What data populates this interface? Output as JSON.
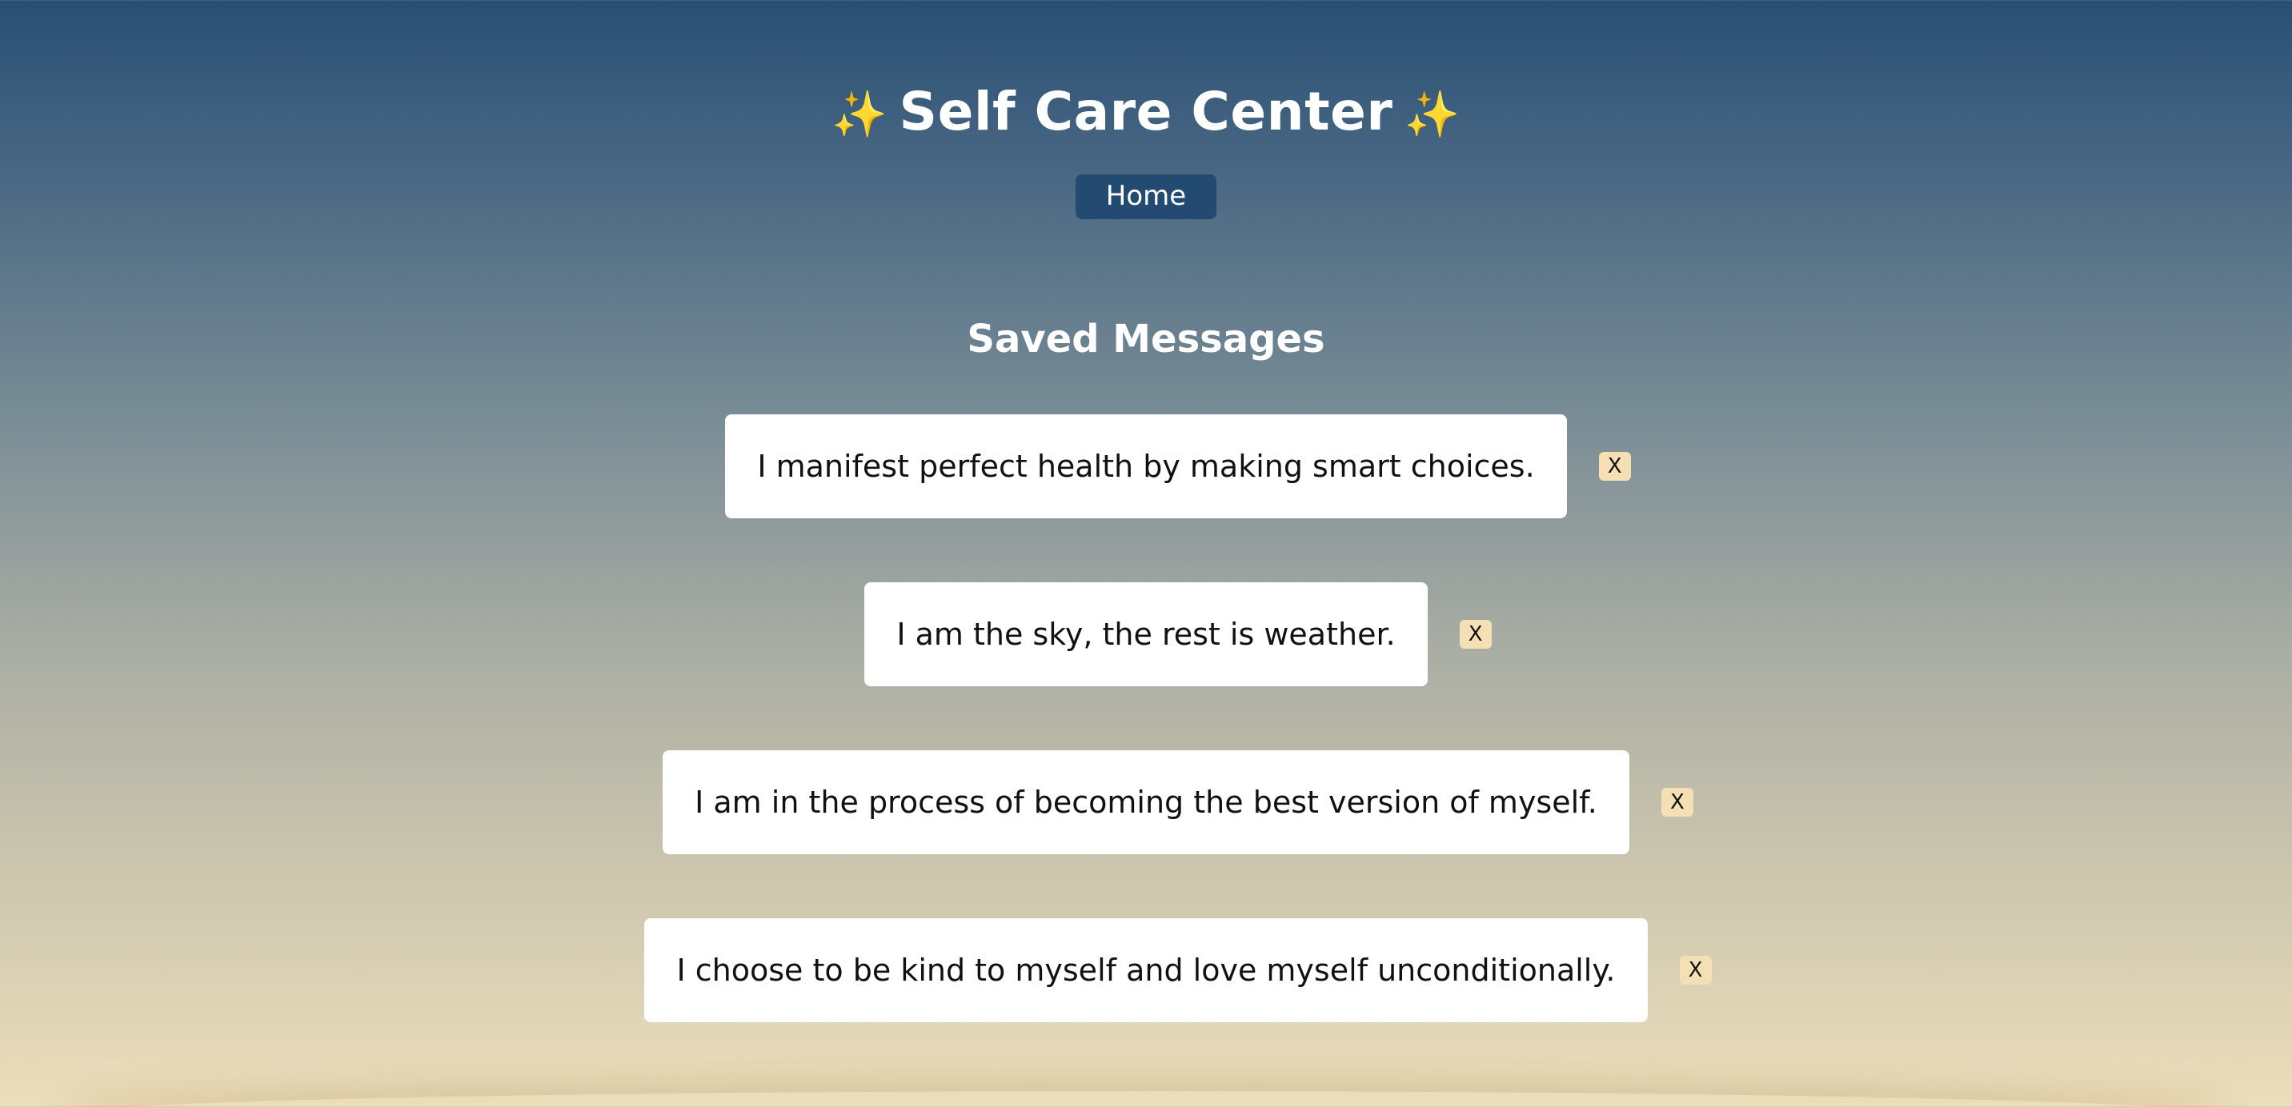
{
  "header": {
    "title": "Self Care Center",
    "sparkle": "✨"
  },
  "nav": {
    "home_label": "Home"
  },
  "saved": {
    "title": "Saved Messages",
    "delete_label": "X",
    "messages": [
      "I manifest perfect health by making smart choices.",
      "I am the sky, the rest is weather.",
      "I am in the process of becoming the best version of myself.",
      "I choose to be kind to myself and love myself unconditionally."
    ]
  },
  "colors": {
    "nav_button": "#234a70",
    "delete_button": "#f5dfb5",
    "gradient_top": "#294f74",
    "gradient_bottom": "#ecdeba",
    "sparkle": "#f7c948"
  }
}
